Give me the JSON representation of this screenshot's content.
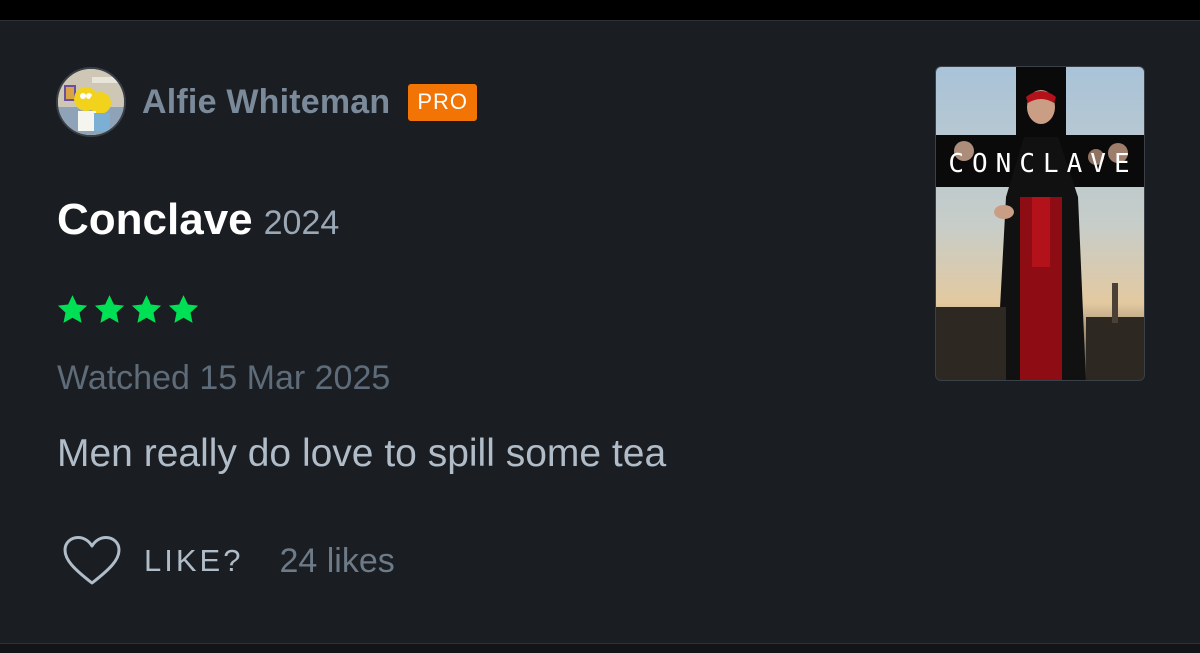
{
  "author": {
    "name": "Alfie Whiteman",
    "badge": "PRO"
  },
  "film": {
    "title": "Conclave",
    "year": "2024",
    "rating_stars": 4,
    "poster_title": "CONCLAVE"
  },
  "diary": {
    "watched_text": "Watched 15 Mar 2025"
  },
  "review": {
    "text": "Men really do love to spill some tea"
  },
  "likes": {
    "label": "LIKE?",
    "count_text": "24 likes"
  },
  "colors": {
    "badge": "#f27405",
    "stars": "#00e054",
    "background": "#1a1d21"
  },
  "icons": [
    "avatar",
    "star-icon",
    "heart-icon"
  ]
}
